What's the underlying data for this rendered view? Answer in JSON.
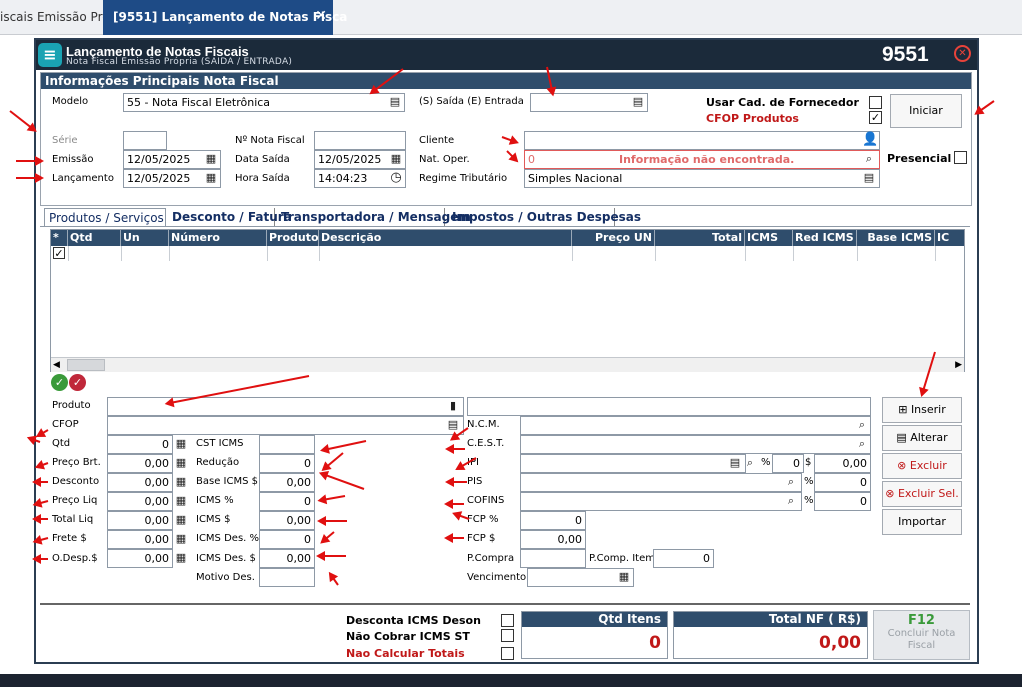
{
  "tabs": [
    {
      "label": "iscais Emissão Pró"
    },
    {
      "label": "[9551] Lançamento de Notas Fisca",
      "close": "✕"
    }
  ],
  "window": {
    "title": "Lançamento de Notas Fiscais",
    "subtitle": "Nota Fiscal Emissão Própria (SAIDA / ENTRADA)",
    "code": "9551",
    "close": "⊗"
  },
  "header": {
    "group_title": "Informações Principais Nota Fiscal",
    "modelo_label": "Modelo",
    "modelo_value": "55 - Nota Fiscal Eletrônica",
    "saida_entrada_label": "(S) Saída (E) Entrada",
    "saida_entrada_value": "",
    "usar_cad_label": "Usar Cad. de Fornecedor",
    "usar_cad_checked": false,
    "cfop_produtos_label": "CFOP Produtos",
    "cfop_produtos_checked": true,
    "iniciar_label": "Iniciar",
    "serie_label": "Série",
    "serie_value": "",
    "nf_label": "Nº Nota Fiscal",
    "nf_value": "",
    "cliente_label": "Cliente",
    "cliente_value": "",
    "emissao_label": "Emissão",
    "emissao_value": "12/05/2025",
    "data_saida_label": "Data Saída",
    "data_saida_value": "12/05/2025",
    "nat_oper_label": "Nat. Oper.",
    "nat_oper_code": "0",
    "nat_oper_value": "Informação não encontrada.",
    "presencial_label": "Presencial",
    "presencial_checked": false,
    "lancamento_label": "Lançamento",
    "lancamento_value": "12/05/2025",
    "hora_saida_label": "Hora Saída",
    "hora_saida_value": "14:04:23",
    "regime_label": "Regime Tributário",
    "regime_value": "Simples Nacional"
  },
  "detail_tabs": [
    {
      "label": "Produtos / Serviços"
    },
    {
      "label": "Desconto / Fatura"
    },
    {
      "label": "Transportadora / Mensagem"
    },
    {
      "label": "Impostos / Outras Despesas"
    }
  ],
  "grid": {
    "columns": [
      "*",
      "Qtd",
      "Un",
      "Número",
      "Produto",
      "Descrição",
      "Preço UN",
      "Total",
      "ICMS",
      "Red ICMS",
      "Base ICMS",
      "IC"
    ],
    "row_checked": true
  },
  "item_form": {
    "produto_label": "Produto",
    "cfop_label": "CFOP",
    "qtd_label": "Qtd",
    "qtd_value": "0",
    "preco_brt_label": "Preço Brt.",
    "preco_brt_value": "0,00",
    "desconto_label": "Desconto",
    "desconto_value": "0,00",
    "preco_liq_label": "Preço Liq",
    "preco_liq_value": "0,00",
    "total_liq_label": "Total Liq",
    "total_liq_value": "0,00",
    "frete_label": "Frete $",
    "frete_value": "0,00",
    "odesp_label": "O.Desp.$",
    "odesp_value": "0,00",
    "cst_icms_label": "CST ICMS",
    "cst_icms_value": "",
    "reducao_label": "Redução",
    "reducao_value": "0",
    "base_icms_label": "Base ICMS $",
    "base_icms_value": "0,00",
    "icms_pct_label": "ICMS %",
    "icms_pct_value": "0",
    "icms_val_label": "ICMS $",
    "icms_val_value": "0,00",
    "icms_des_pct_label": "ICMS Des. %",
    "icms_des_pct_value": "0",
    "icms_des_val_label": "ICMS Des. $",
    "icms_des_val_value": "0,00",
    "motivo_des_label": "Motivo Des.",
    "ncm_label": "N.C.M.",
    "cest_label": "C.E.S.T.",
    "ipi_label": "IPI",
    "ipi_pct_symbol": "%",
    "ipi_pct_value": "0",
    "ipi_val_symbol": "$",
    "ipi_val_value": "0,00",
    "pis_label": "PIS",
    "pis_pct_symbol": "%",
    "pis_pct_value": "0",
    "cofins_label": "COFINS",
    "cofins_pct_symbol": "%",
    "cofins_pct_value": "0",
    "fcp_pct_label": "FCP %",
    "fcp_pct_value": "0",
    "fcp_val_label": "FCP $",
    "fcp_val_value": "0,00",
    "pcompra_label": "P.Compra",
    "pcomp_item_label": "P.Comp. Item",
    "pcomp_item_value": "0",
    "vencimento_label": "Vencimento"
  },
  "actions": {
    "inserir": "Inserir",
    "alterar": "Alterar",
    "excluir": "Excluir",
    "excluir_sel": "Excluir Sel.",
    "importar": "Importar"
  },
  "footer": {
    "desconta_icms_label": "Desconta ICMS Deson",
    "nao_cobrar_label": "Não Cobrar ICMS ST",
    "nao_calcular_label": "Nao Calcular Totais",
    "qtd_itens_label": "Qtd Itens",
    "qtd_itens_value": "0",
    "total_nf_label": "Total NF ( R$)",
    "total_nf_value": "0,00",
    "concluir_key": "F12",
    "concluir_label": "Concluir Nota Fiscal"
  },
  "colors": {
    "header_bar": "#1b2a3a",
    "section_bar": "#2f4d6c",
    "error_red": "#c01818",
    "annotation_red": "#e01010"
  }
}
